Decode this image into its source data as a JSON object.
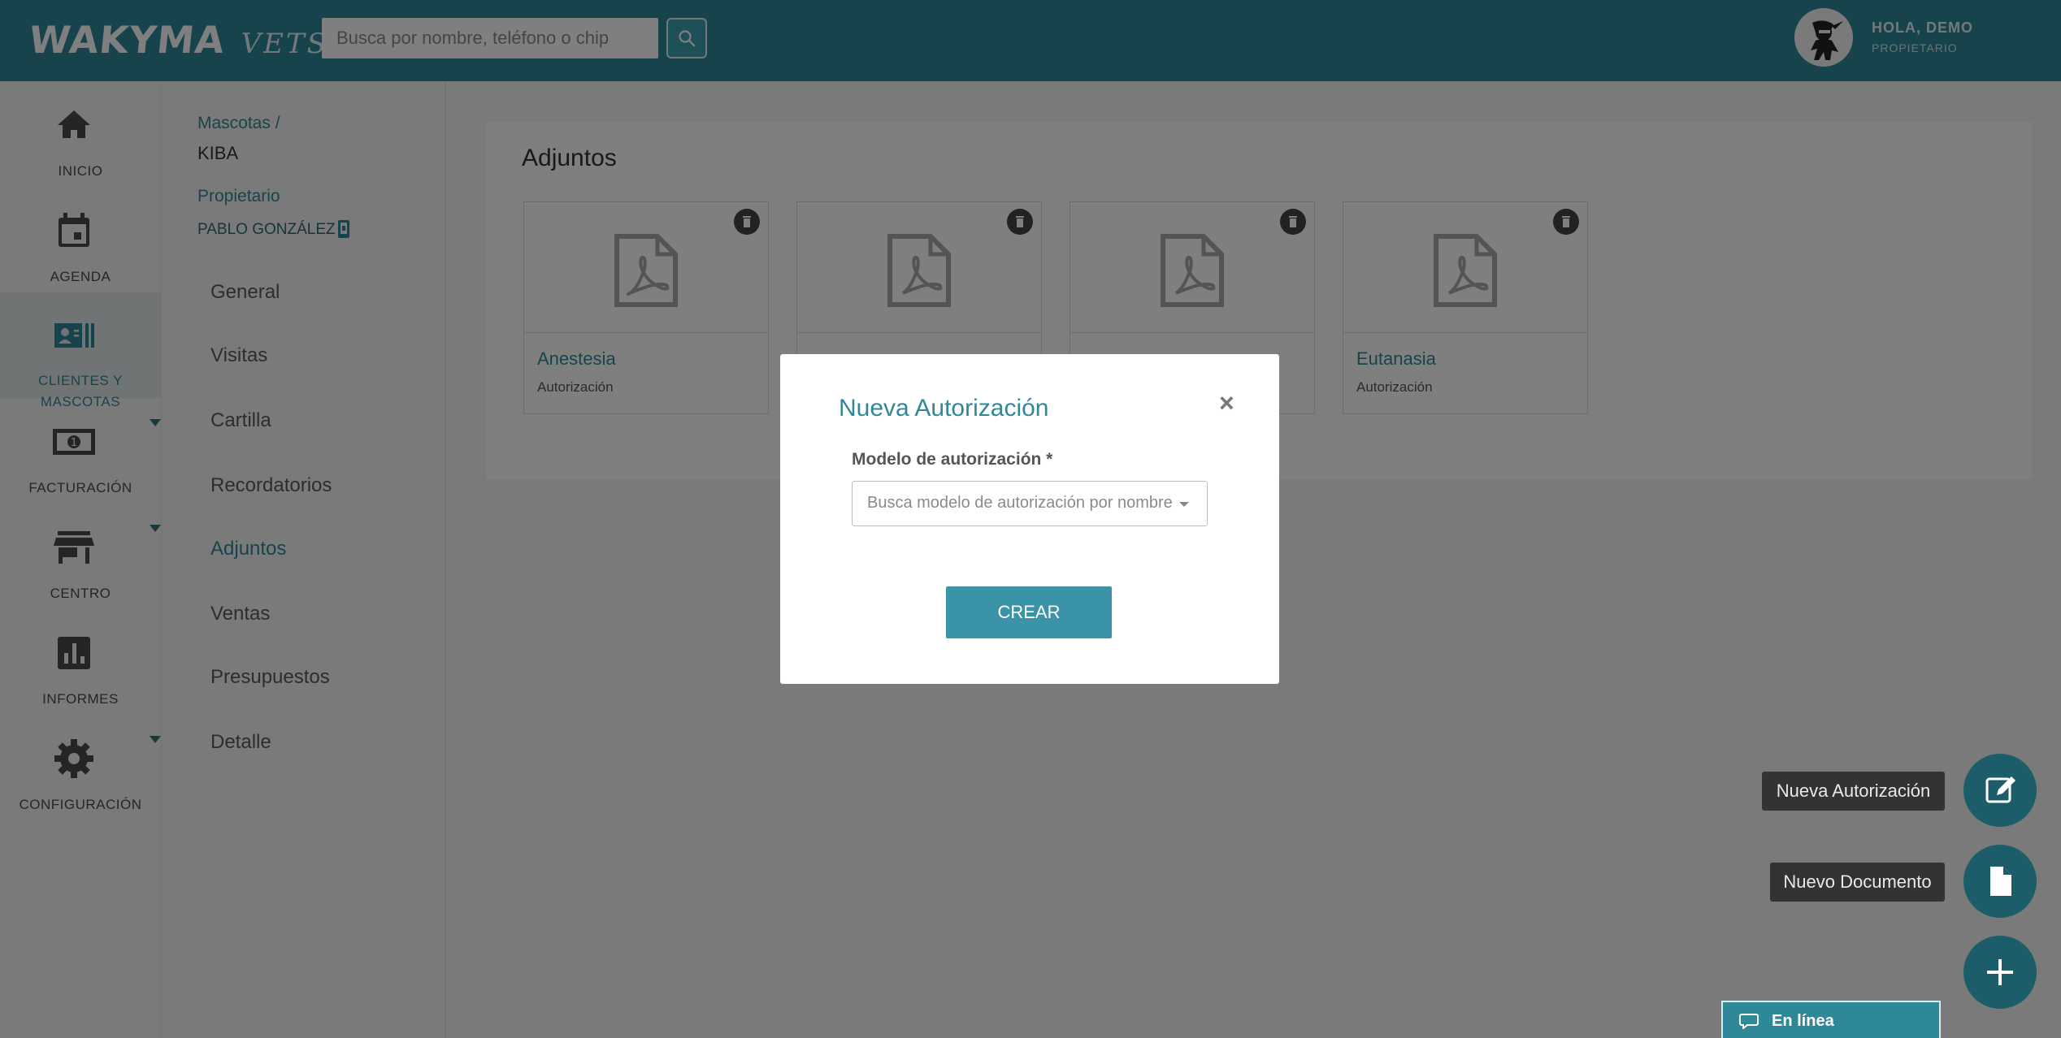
{
  "app": {
    "logo_main": "WAKYMA",
    "logo_sub": "VETS"
  },
  "header": {
    "search_placeholder": "Busca por nombre, teléfono o chip",
    "user_greeting": "HOLA, DEMO",
    "user_role": "PROPIETARIO"
  },
  "sidebar": {
    "items": [
      {
        "label": "INICIO",
        "icon": "home-icon"
      },
      {
        "label": "AGENDA",
        "icon": "calendar-icon"
      },
      {
        "label": "CLIENTES Y MASCOTAS",
        "icon": "contacts-card-icon",
        "active": true
      },
      {
        "label": "FACTURACIÓN",
        "icon": "money-icon"
      },
      {
        "label": "CENTRO",
        "icon": "store-icon"
      },
      {
        "label": "INFORMES",
        "icon": "bar-chart-icon"
      },
      {
        "label": "CONFIGURACIÓN",
        "icon": "gear-icon"
      }
    ]
  },
  "subnav": {
    "breadcrumb": "Mascotas",
    "breadcrumb_sep": "/",
    "pet_name": "KIBA",
    "owner_label": "Propietario",
    "owner_name": "PABLO GONZÁLEZ",
    "items": [
      "General",
      "Visitas",
      "Cartilla",
      "Recordatorios",
      "Adjuntos",
      "Ventas",
      "Presupuestos",
      "Detalle"
    ],
    "active": "Adjuntos"
  },
  "main": {
    "title": "Adjuntos",
    "cards": [
      {
        "name": "Anestesia",
        "type": "Autorización"
      },
      {
        "name": "",
        "type": ""
      },
      {
        "name": "",
        "type": ""
      },
      {
        "name": "Eutanasia",
        "type": "Autorización"
      }
    ]
  },
  "modal": {
    "title": "Nueva Autorización",
    "close": "×",
    "field_label": "Modelo de autorización *",
    "select_placeholder": "Busca modelo de autorización por nombre",
    "submit": "CREAR"
  },
  "fab": {
    "tip_authorization": "Nueva Autorización",
    "tip_document": "Nuevo Documento"
  },
  "chat": {
    "label": "En línea"
  },
  "colors": {
    "primary": "#2f8898",
    "fab": "#1d5d6a",
    "button": "#3a93a6"
  }
}
